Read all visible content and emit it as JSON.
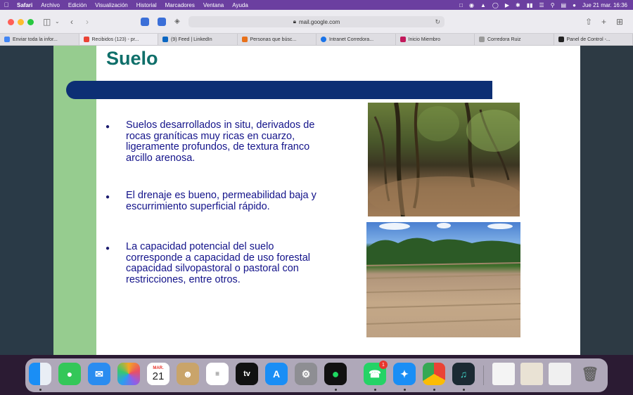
{
  "menubar": {
    "items": [
      "Safari",
      "Archivo",
      "Edición",
      "Visualización",
      "Historial",
      "Marcadores",
      "Ventana",
      "Ayuda"
    ],
    "clock": "Jue 21 mar.  16:36"
  },
  "toolbar": {
    "url": "mail.google.com"
  },
  "tabs": [
    {
      "label": "Enviar toda la infor...",
      "color": "#4285f4"
    },
    {
      "label": "Recibidos (123) - pr...",
      "color": "#ea4335"
    },
    {
      "label": "(9) Feed | LinkedIn",
      "color": "#0a66c2"
    },
    {
      "label": "Personas que búsc...",
      "color": "#e8711a"
    },
    {
      "label": "Intranet Corredora...",
      "color": "#1a73e8"
    },
    {
      "label": "Inicio Miembro",
      "color": "#c2185b"
    },
    {
      "label": "Corredora Ruiz",
      "color": "#999999"
    },
    {
      "label": "Panel de Control -...",
      "color": "#222222"
    }
  ],
  "slide": {
    "title": "Suelo",
    "bullets": [
      "Suelos desarrollados in situ, derivados de rocas graníticas muy ricas en cuarzo, ligeramente profundos, de textura franco arcillo arenosa.",
      "El drenaje es bueno, permeabilidad baja y escurrimiento superficial rápido.",
      "La capacidad potencial del suelo corresponde a capacidad de uso forestal capacidad silvopastoral o pastoral con restricciones, entre otros."
    ]
  },
  "dock": {
    "calendar_month": "MAR.",
    "calendar_day": "21",
    "tv_label": "tv",
    "whatsapp_badge": "1"
  }
}
